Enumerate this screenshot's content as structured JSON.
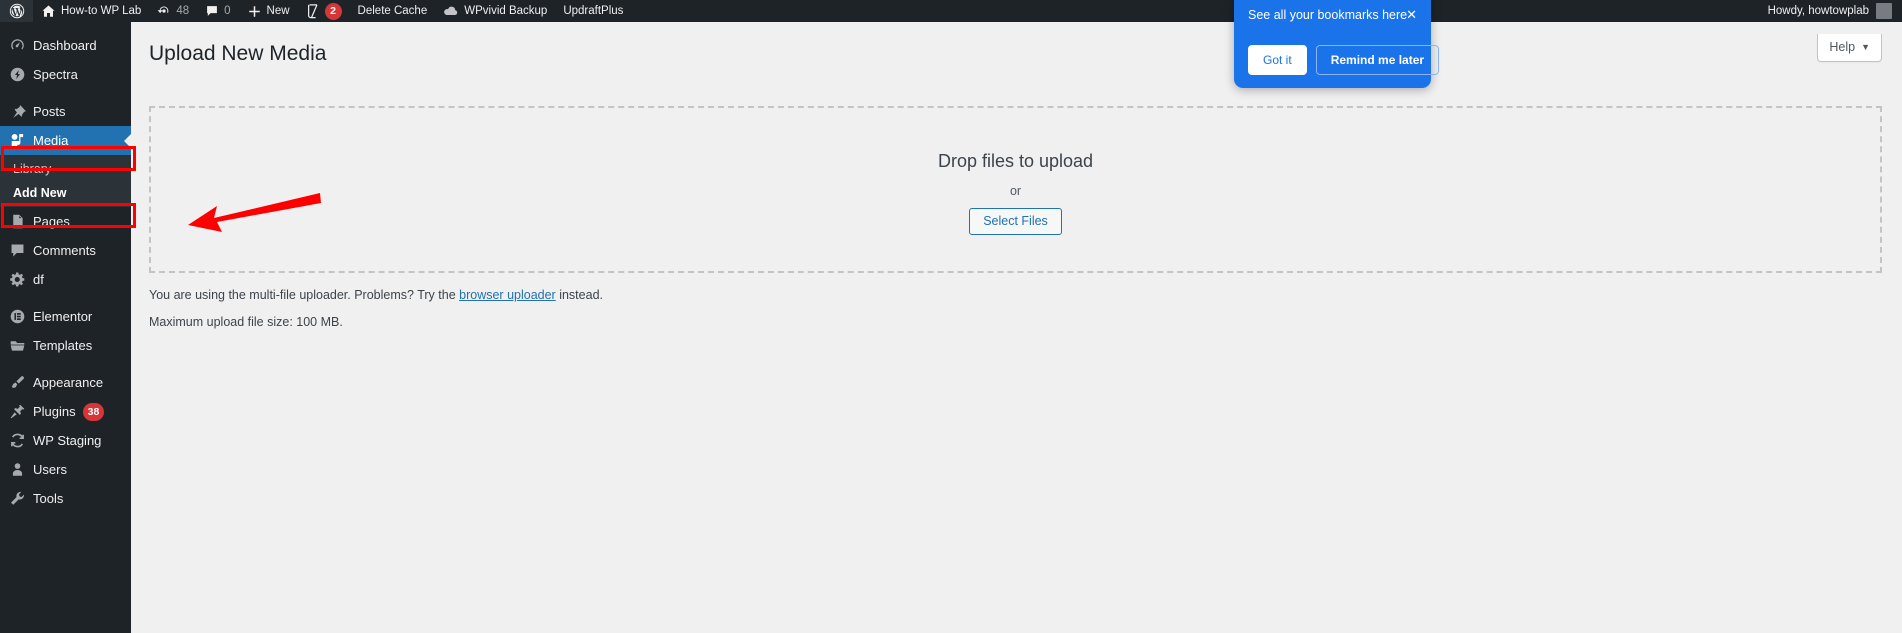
{
  "adminbar": {
    "logo_icon": "wordpress-logo-icon",
    "site_name": "How-to WP Lab",
    "site_icon": "home-icon",
    "updates": {
      "icon": "updates-icon",
      "count": "48"
    },
    "comments": {
      "icon": "comment-bubble-icon",
      "count": "0"
    },
    "new": {
      "icon": "plus-icon",
      "label": "New"
    },
    "yoast": {
      "icon": "yoast-seo-icon",
      "badge": "2"
    },
    "delete_cache": "Delete Cache",
    "wpvivid": {
      "icon": "cloud-icon",
      "label": "WPvivid Backup"
    },
    "updraftplus": "UpdraftPlus",
    "howdy": "Howdy, howtowplab",
    "avatar_icon": "avatar-icon"
  },
  "sidebar": {
    "items": [
      {
        "label": "Dashboard",
        "icon": "dashboard-icon",
        "badge": ""
      },
      {
        "label": "Spectra",
        "icon": "spectra-icon",
        "badge": ""
      },
      {
        "label": "Posts",
        "icon": "pin-icon",
        "badge": ""
      },
      {
        "label": "Media",
        "icon": "media-icon",
        "badge": ""
      },
      {
        "label": "Pages",
        "icon": "pages-icon",
        "badge": ""
      },
      {
        "label": "Comments",
        "icon": "comments-icon",
        "badge": ""
      },
      {
        "label": "df",
        "icon": "gear-icon",
        "badge": ""
      },
      {
        "label": "Elementor",
        "icon": "elementor-icon",
        "badge": ""
      },
      {
        "label": "Templates",
        "icon": "folder-icon",
        "badge": ""
      },
      {
        "label": "Appearance",
        "icon": "paintbrush-icon",
        "badge": ""
      },
      {
        "label": "Plugins",
        "icon": "plugin-icon",
        "badge": "38"
      },
      {
        "label": "WP Staging",
        "icon": "sync-icon",
        "badge": ""
      },
      {
        "label": "Users",
        "icon": "user-icon",
        "badge": ""
      },
      {
        "label": "Tools",
        "icon": "wrench-icon",
        "badge": ""
      }
    ],
    "media_submenu": [
      {
        "label": "Library",
        "current": false
      },
      {
        "label": "Add New",
        "current": true
      }
    ]
  },
  "content": {
    "help_label": "Help",
    "help_caret": "▼",
    "page_title": "Upload New Media",
    "drop_heading": "Drop files to upload",
    "drop_or": "or",
    "select_files_label": "Select Files",
    "note_prefix": "You are using the multi-file uploader. Problems? Try the ",
    "note_link": "browser uploader",
    "note_suffix": " instead.",
    "max_upload": "Maximum upload file size: 100 MB."
  },
  "bookmark_popup": {
    "title": "See all your bookmarks here",
    "close_icon": "close-icon",
    "close_glyph": "✕",
    "got_it": "Got it",
    "remind_later": "Remind me later"
  },
  "annotations": {
    "arrow_color": "#ff0000",
    "box_color": "#ff0000"
  },
  "colors": {
    "admin_dark": "#1d2327",
    "accent_blue": "#2271b1",
    "popup_blue": "#1a73e8",
    "badge_red": "#d63638"
  }
}
